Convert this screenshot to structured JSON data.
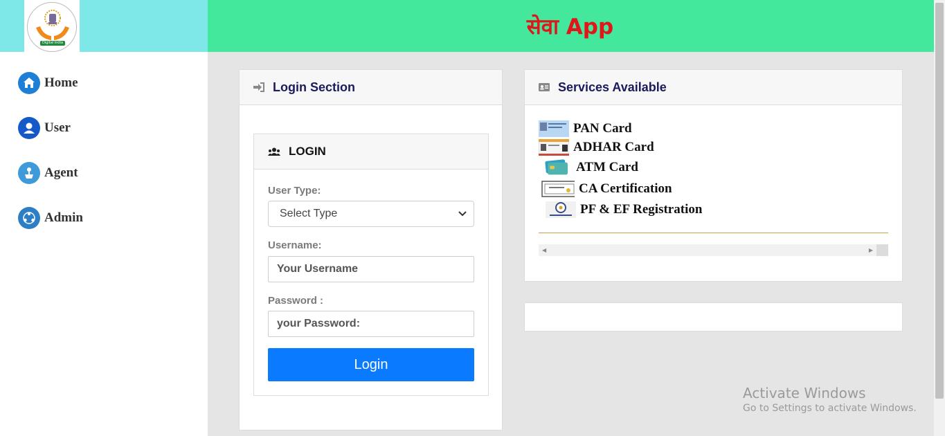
{
  "header": {
    "logo_text": "Digital India",
    "app_title": "सेवा App"
  },
  "sidebar": {
    "items": [
      {
        "label": "Home",
        "icon": "home-icon"
      },
      {
        "label": "User",
        "icon": "user-icon"
      },
      {
        "label": "Agent",
        "icon": "agent-icon"
      },
      {
        "label": "Admin",
        "icon": "admin-icon"
      }
    ]
  },
  "login_section": {
    "title": "Login Section",
    "icon": "sign-in-icon",
    "inner_title": "LOGIN",
    "inner_icon": "users-icon",
    "user_type_label": "User Type:",
    "user_type_value": "Select Type",
    "username_label": "Username:",
    "username_placeholder": "Your Username",
    "password_label": "Password :",
    "password_placeholder": "your Password:",
    "login_button": "Login"
  },
  "services": {
    "title": "Services Available",
    "icon": "id-card-icon",
    "items": [
      {
        "label": "PAN Card"
      },
      {
        "label": "ADHAR Card"
      },
      {
        "label": "ATM Card"
      },
      {
        "label": "CA Certification"
      },
      {
        "label": "PF & EF Registration"
      }
    ]
  },
  "watermark": {
    "title": "Activate Windows",
    "subtitle": "Go to Settings to activate Windows."
  },
  "colors": {
    "header_bg": "#43e89d",
    "logo_bg": "#7ee8e8",
    "title_color": "#e0161b",
    "button_bg": "#0a7bff"
  }
}
